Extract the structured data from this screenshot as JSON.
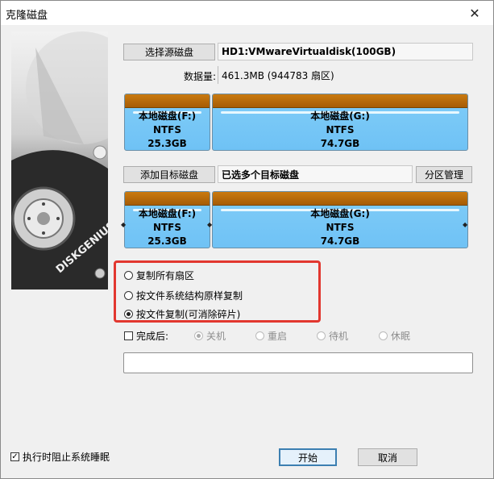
{
  "window": {
    "title": "克隆磁盘",
    "close_glyph": "✕"
  },
  "side_image": {
    "brand_text": "DISKGENIUS"
  },
  "source": {
    "button_label": "选择源磁盘",
    "disk_name": "HD1:VMwareVirtualdisk(100GB)",
    "data_label": "数据量:",
    "data_value": "461.3MB (944783 扇区)"
  },
  "source_partitions": [
    {
      "name": "本地磁盘(F:)",
      "fs": "NTFS",
      "size": "25.3GB"
    },
    {
      "name": "本地磁盘(G:)",
      "fs": "NTFS",
      "size": "74.7GB"
    }
  ],
  "target": {
    "button_label": "添加目标磁盘",
    "disk_value": "已选多个目标磁盘",
    "partition_manage_label": "分区管理"
  },
  "target_partitions": [
    {
      "name": "本地磁盘(F:)",
      "fs": "NTFS",
      "size": "25.3GB"
    },
    {
      "name": "本地磁盘(G:)",
      "fs": "NTFS",
      "size": "74.7GB"
    }
  ],
  "copy_modes": [
    {
      "label": "复制所有扇区",
      "selected": false
    },
    {
      "label": "按文件系统结构原样复制",
      "selected": false
    },
    {
      "label": "按文件复制(可消除碎片)",
      "selected": true
    }
  ],
  "after_done": {
    "label": "完成后:",
    "checked": false,
    "options": [
      {
        "label": "关机",
        "selected": true
      },
      {
        "label": "重启",
        "selected": false
      },
      {
        "label": "待机",
        "selected": false
      },
      {
        "label": "休眠",
        "selected": false
      }
    ]
  },
  "progress": {
    "value": 0
  },
  "prevent_sleep": {
    "label": "执行时阻止系统睡眠",
    "checked": true
  },
  "buttons": {
    "start": "开始",
    "cancel": "取消"
  },
  "colors": {
    "partition_fill": "#7ccaf7",
    "partition_cap": "#a65c05",
    "highlight": "#e2372f"
  }
}
